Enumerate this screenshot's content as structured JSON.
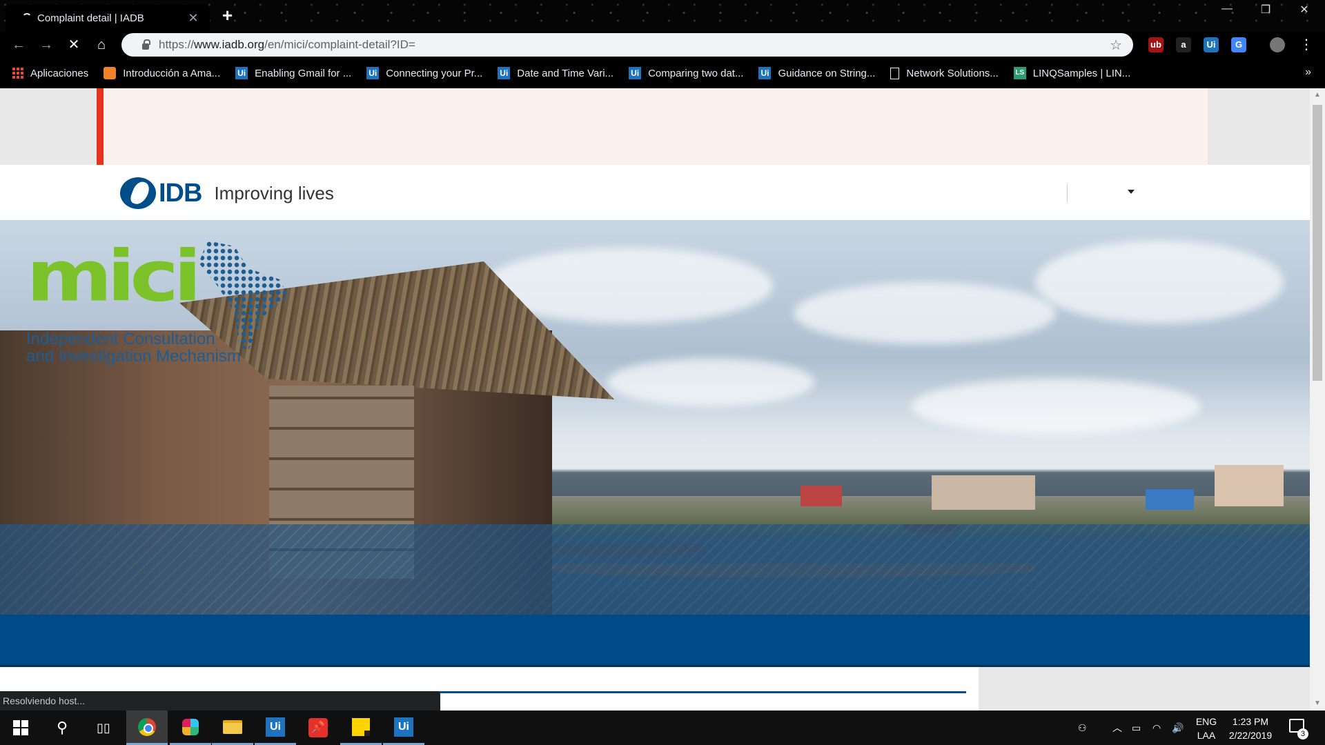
{
  "browser": {
    "tab_title": "Complaint detail | IADB",
    "tab_close": "✕",
    "new_tab": "+",
    "url_prefix": "https://",
    "url_host": "www.iadb.org",
    "url_path": "/en/mici/complaint-detail?ID=",
    "status_text": "Resolviendo host...",
    "window_controls": [
      "—",
      "❐",
      "✕"
    ],
    "extensions": [
      {
        "label": "ub",
        "color": "#a31515"
      },
      {
        "label": "a",
        "color": "#222222"
      },
      {
        "label": "Ui",
        "color": "#1e73be"
      },
      {
        "label": "G",
        "color": "#4285f4"
      }
    ]
  },
  "bookmarks": [
    {
      "icon": "apps",
      "label": "Aplicaciones"
    },
    {
      "icon": "hex",
      "label": "Introducción a Ama..."
    },
    {
      "icon": "Ui",
      "label": "Enabling Gmail for ..."
    },
    {
      "icon": "Ui",
      "label": "Connecting your Pr..."
    },
    {
      "icon": "Ui",
      "label": "Date and Time Vari..."
    },
    {
      "icon": "Ui",
      "label": "Comparing two dat..."
    },
    {
      "icon": "Ui",
      "label": "Guidance on String..."
    },
    {
      "icon": "page",
      "label": "Network Solutions..."
    },
    {
      "icon": "LS",
      "label": "LINQSamples | LIN..."
    }
  ],
  "page": {
    "logo_text": "IDB",
    "tagline": "Improving lives",
    "mici_word": "mici",
    "mici_subtitle_1": "Independent Consultation",
    "mici_subtitle_2": "and Investigation Mechanism"
  },
  "taskbar": {
    "lang_1": "ENG",
    "lang_2": "LAA",
    "time": "1:23 PM",
    "date": "2/22/2019",
    "notification_count": "3"
  },
  "colors": {
    "alert_accent": "#e8321c",
    "idb_blue": "#004e89",
    "mici_green": "#7cc22a",
    "band_blue": "#004b87"
  }
}
